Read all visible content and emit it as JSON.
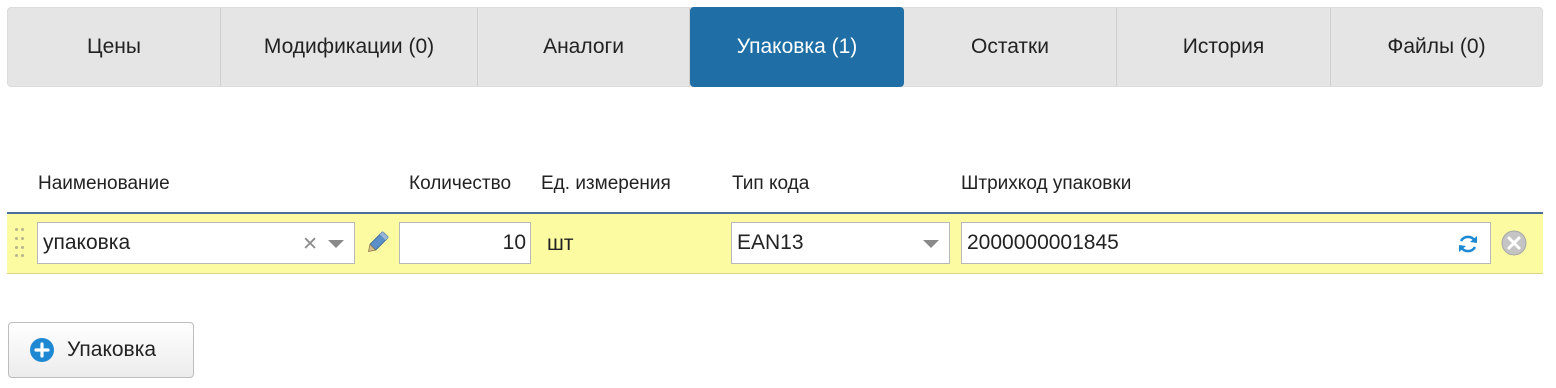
{
  "tabs": [
    {
      "label": "Цены",
      "active": false
    },
    {
      "label": "Модификации (0)",
      "active": false
    },
    {
      "label": "Аналоги",
      "active": false
    },
    {
      "label": "Упаковка (1)",
      "active": true
    },
    {
      "label": "Остатки",
      "active": false
    },
    {
      "label": "История",
      "active": false
    },
    {
      "label": "Файлы (0)",
      "active": false
    }
  ],
  "columns": {
    "name": "Наименование",
    "quantity": "Количество",
    "unit": "Ед. измерения",
    "code_type": "Тип кода",
    "barcode": "Штрихкод упаковки"
  },
  "row": {
    "name": "упаковка",
    "quantity": "10",
    "unit": "шт",
    "code_type": "EAN13",
    "barcode": "2000000001845"
  },
  "add_button": {
    "label": "Упаковка"
  },
  "icons": {
    "drag": "drag-handle-icon",
    "clear": "clear-icon",
    "dropdown": "chevron-down-icon",
    "edit": "pencil-icon",
    "regenerate": "refresh-icon",
    "remove": "remove-icon",
    "add": "plus-circle-icon"
  },
  "colors": {
    "active_tab": "#1f6fa6",
    "row_highlight": "#fdfba2",
    "accent_blue": "#1e88d2"
  }
}
